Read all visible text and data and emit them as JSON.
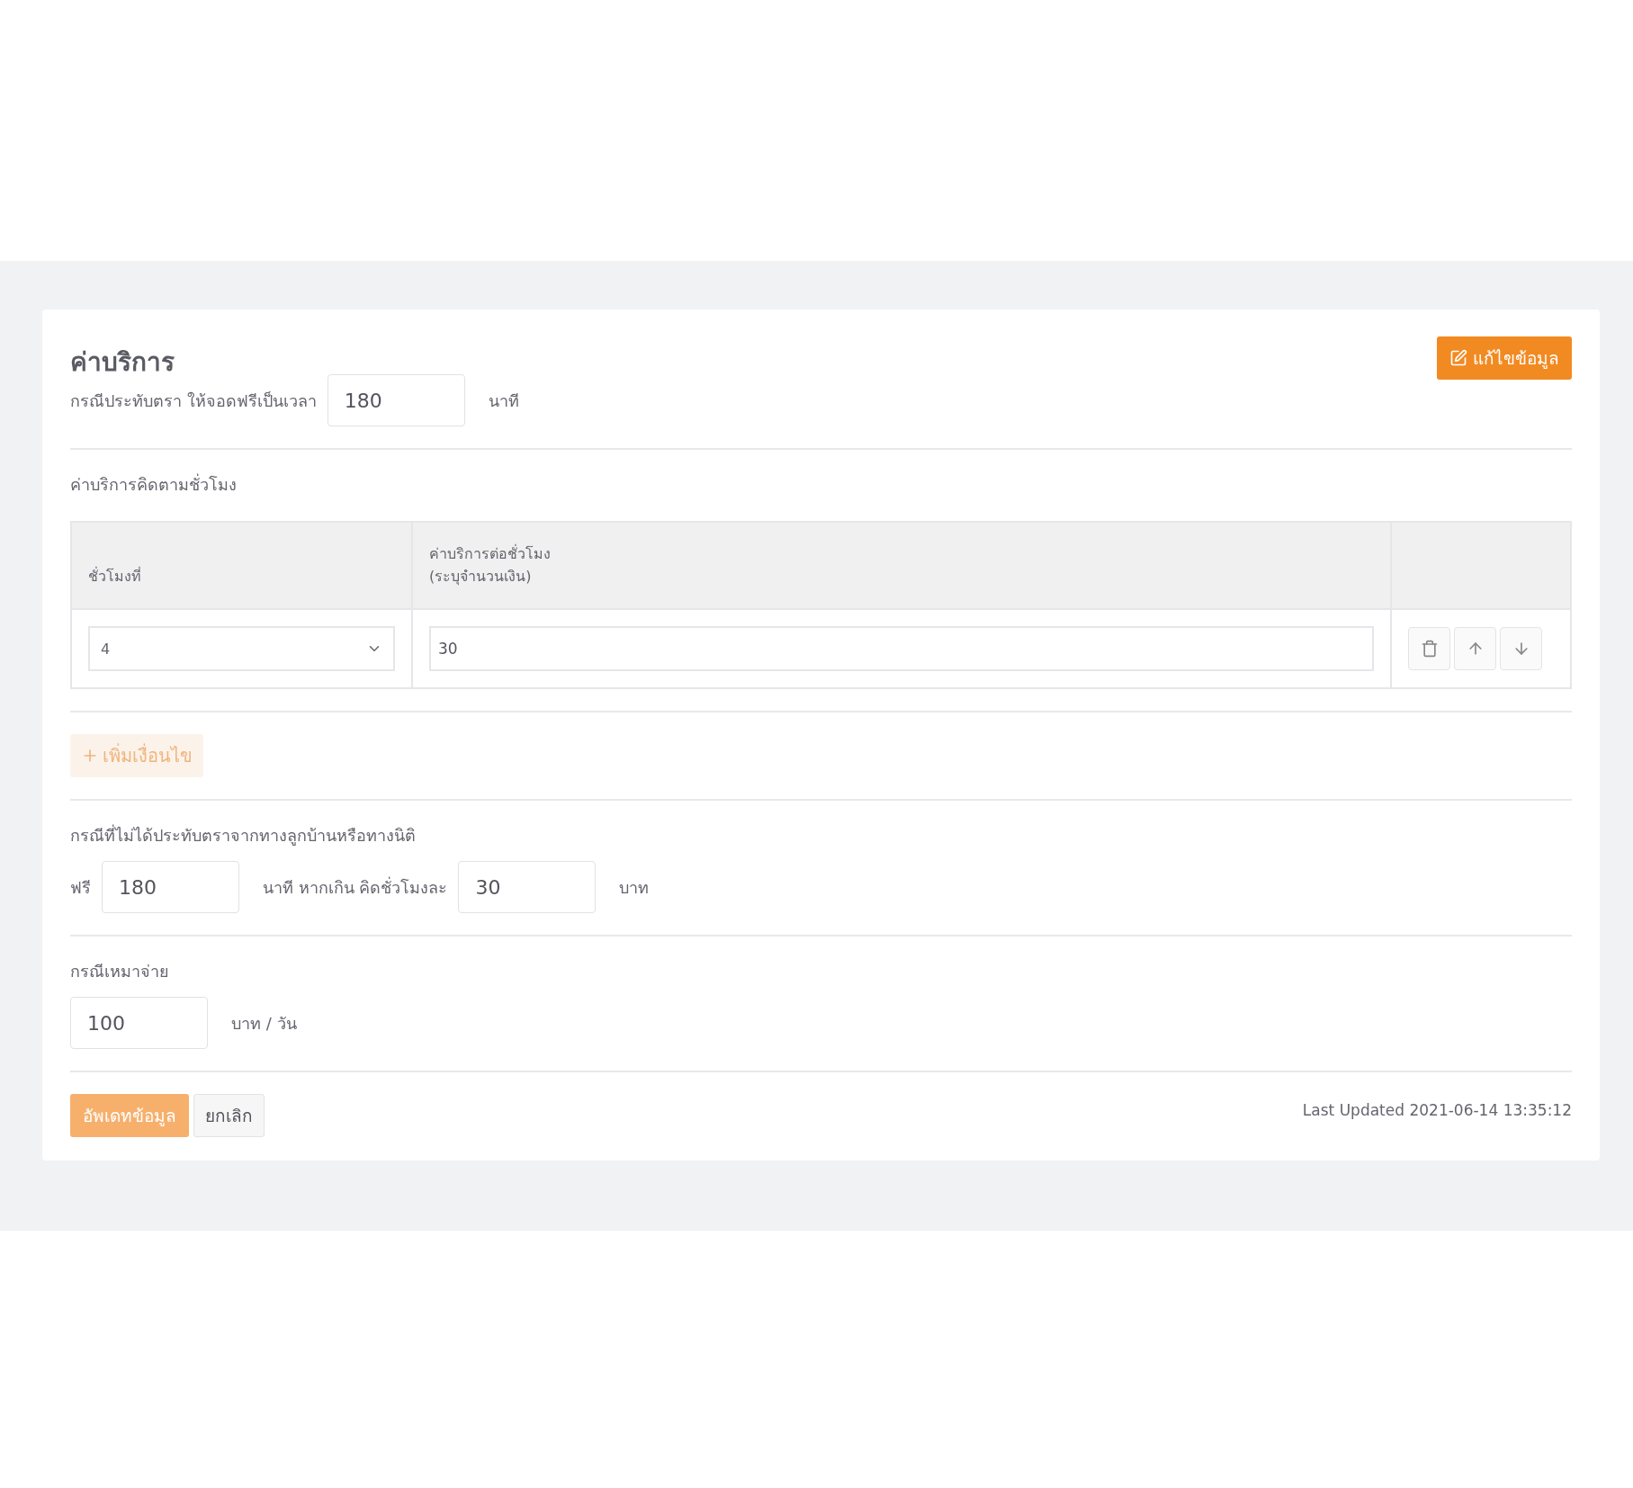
{
  "card": {
    "title": "ค่าบริการ",
    "edit_button": "แก้ไขข้อมูล"
  },
  "stamp_free": {
    "label": "กรณีประทับตรา ให้จอดฟรีเป็นเวลา",
    "value": "180",
    "unit": "นาที"
  },
  "hourly": {
    "label": "ค่าบริการคิดตามชั่วโมง",
    "columns": [
      "ชั่วโมงที่",
      "ค่าบริการต่อชั่วโมง\n(ระบุจำนวนเงิน)"
    ],
    "rows": [
      {
        "hour": "4",
        "price": "30"
      }
    ],
    "add_button": {
      "label": "เพิ่มเงื่อนไข",
      "disabled": true
    }
  },
  "no_stamp": {
    "label": "กรณีที่ไม่ได้ประทับตราจากทางลูกบ้านหรือทางนิติ",
    "prefix": "ฟรี",
    "free_value": "180",
    "middle": "นาที หากเกิน คิดชั่วโมงละ",
    "rate_value": "30",
    "unit": "บาท"
  },
  "flat": {
    "label": "กรณีเหมาจ่าย",
    "value": "100",
    "unit": "บาท / วัน"
  },
  "actions": {
    "update": {
      "label": "อัพเดทข้อมูล",
      "disabled": true
    },
    "cancel": "ยกเลิก"
  },
  "last_updated": "Last Updated 2021-06-14 13:35:12"
}
